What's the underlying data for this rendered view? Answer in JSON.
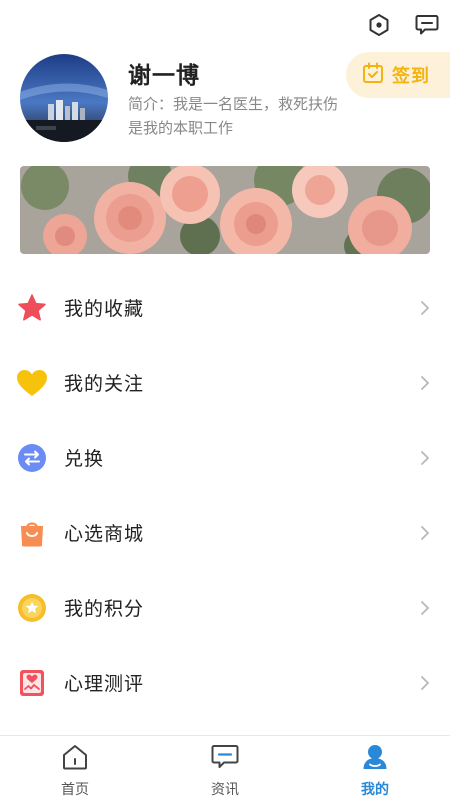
{
  "topbar": {
    "settings_icon": "hexagon-settings-icon",
    "message_icon": "message-icon"
  },
  "profile": {
    "name": "谢一博",
    "bio": "简介：我是一名医生，救死扶伤是我的本职工作",
    "checkin_label": "签到",
    "checkin_color": "#f3b310"
  },
  "menu": {
    "items": [
      {
        "label": "我的收藏",
        "icon": "star-icon",
        "color": "#ef4d5a"
      },
      {
        "label": "我的关注",
        "icon": "heart-icon",
        "color": "#f7c20c"
      },
      {
        "label": "兑换",
        "icon": "exchange-icon",
        "color": "#6b8cf5"
      },
      {
        "label": "心选商城",
        "icon": "shopping-bag-icon",
        "color": "#f78d52"
      },
      {
        "label": "我的积分",
        "icon": "points-icon",
        "color": "#f7be2b"
      },
      {
        "label": "心理测评",
        "icon": "psych-test-icon",
        "color": "#f0525e"
      }
    ]
  },
  "tabbar": {
    "tabs": [
      {
        "label": "首页",
        "icon": "home-icon"
      },
      {
        "label": "资讯",
        "icon": "news-icon"
      },
      {
        "label": "我的",
        "icon": "profile-icon",
        "active": true
      }
    ],
    "active_color": "#2a88d8"
  }
}
